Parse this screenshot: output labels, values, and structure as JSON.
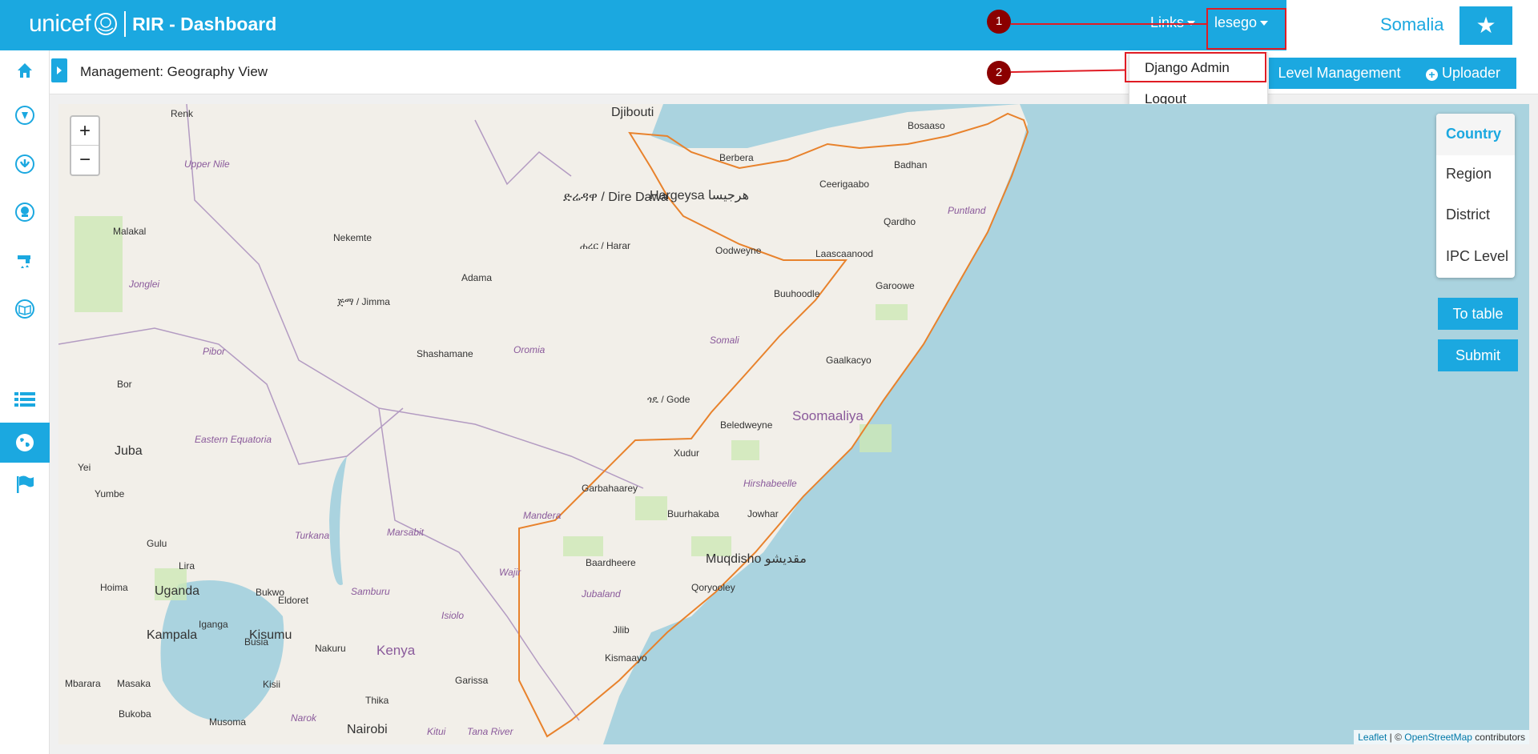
{
  "header": {
    "logo_text": "unicef",
    "app_title": "RIR - Dashboard",
    "links_label": "Links",
    "user_label": "lesego",
    "country": "Somalia"
  },
  "user_menu": {
    "items": [
      "Django Admin",
      "Logout"
    ]
  },
  "annotations": [
    "1",
    "2"
  ],
  "subheader": {
    "title": "Management: Geography View",
    "level_management_label": "Level Management",
    "uploader_label": "Uploader"
  },
  "sidebar": {
    "items": [
      {
        "icon": "home-icon"
      },
      {
        "icon": "nutrition-icon"
      },
      {
        "icon": "protection-icon"
      },
      {
        "icon": "health-icon"
      },
      {
        "icon": "wash-icon"
      },
      {
        "icon": "education-icon"
      },
      {
        "icon": "list-icon"
      },
      {
        "icon": "globe-icon",
        "active": true
      },
      {
        "icon": "flag-icon"
      }
    ]
  },
  "map": {
    "zoom_in": "+",
    "zoom_out": "−",
    "levels": [
      "Country",
      "Region",
      "District",
      "IPC Level"
    ],
    "active_level": "Country",
    "to_table_label": "To table",
    "submit_label": "Submit",
    "attribution": {
      "leaflet": "Leaflet",
      "sep": " | © ",
      "osm": "OpenStreetMap",
      "suffix": " contributors"
    },
    "labels": [
      {
        "text": "Djibouti",
        "cls": "big"
      },
      {
        "text": "Hargeysa هرجيسا",
        "cls": "big"
      },
      {
        "text": "Berbera",
        "cls": ""
      },
      {
        "text": "Bosaaso",
        "cls": ""
      },
      {
        "text": "Ceerigaabo",
        "cls": ""
      },
      {
        "text": "Badhan",
        "cls": ""
      },
      {
        "text": "Qardho",
        "cls": ""
      },
      {
        "text": "Puntland",
        "cls": "region"
      },
      {
        "text": "Oodweyne",
        "cls": ""
      },
      {
        "text": "Laascaanood",
        "cls": ""
      },
      {
        "text": "Garoowe",
        "cls": ""
      },
      {
        "text": "Buuhoodle",
        "cls": ""
      },
      {
        "text": "Gaalkacyo",
        "cls": ""
      },
      {
        "text": "Soomaaliya",
        "cls": "country"
      },
      {
        "text": "Beledweyne",
        "cls": ""
      },
      {
        "text": "Xudur",
        "cls": ""
      },
      {
        "text": "Garbahaarey",
        "cls": ""
      },
      {
        "text": "Buurhakaba",
        "cls": ""
      },
      {
        "text": "Jowhar",
        "cls": ""
      },
      {
        "text": "Hirshabeelle",
        "cls": "region"
      },
      {
        "text": "Muqdisho مقديشو",
        "cls": "big"
      },
      {
        "text": "Baardheere",
        "cls": ""
      },
      {
        "text": "Qoryooley",
        "cls": ""
      },
      {
        "text": "Jubaland",
        "cls": "region"
      },
      {
        "text": "Jilib",
        "cls": ""
      },
      {
        "text": "Kismaayo",
        "cls": ""
      },
      {
        "text": "ጎዴ / Gode",
        "cls": ""
      },
      {
        "text": "Adama",
        "cls": ""
      },
      {
        "text": "ጅማ / Jimma",
        "cls": ""
      },
      {
        "text": "ሐረር / Harar",
        "cls": ""
      },
      {
        "text": "ድሬዳዋ / Dire Dawa",
        "cls": "big"
      },
      {
        "text": "Nekemte",
        "cls": ""
      },
      {
        "text": "Shashamane",
        "cls": ""
      },
      {
        "text": "Malakal",
        "cls": ""
      },
      {
        "text": "Renk",
        "cls": ""
      },
      {
        "text": "Bor",
        "cls": ""
      },
      {
        "text": "Juba",
        "cls": "big"
      },
      {
        "text": "Yei",
        "cls": ""
      },
      {
        "text": "Yumbe",
        "cls": ""
      },
      {
        "text": "Gulu",
        "cls": ""
      },
      {
        "text": "Lira",
        "cls": ""
      },
      {
        "text": "Uganda",
        "cls": "big"
      },
      {
        "text": "Kampala",
        "cls": "big"
      },
      {
        "text": "Hoima",
        "cls": ""
      },
      {
        "text": "Kisumu",
        "cls": "big"
      },
      {
        "text": "Kenya",
        "cls": "country"
      },
      {
        "text": "Nairobi",
        "cls": "big"
      },
      {
        "text": "Eldoret",
        "cls": ""
      },
      {
        "text": "Nakuru",
        "cls": ""
      },
      {
        "text": "Garissa",
        "cls": ""
      },
      {
        "text": "Upper Nile",
        "cls": "region"
      },
      {
        "text": "Jonglei",
        "cls": "region"
      },
      {
        "text": "Pibor",
        "cls": "region"
      },
      {
        "text": "Eastern Equatoria",
        "cls": "region"
      },
      {
        "text": "Turkana",
        "cls": "region"
      },
      {
        "text": "Marsabit",
        "cls": "region"
      },
      {
        "text": "Samburu",
        "cls": "region"
      },
      {
        "text": "Isiolo",
        "cls": "region"
      },
      {
        "text": "Wajir",
        "cls": "region"
      },
      {
        "text": "Mandera",
        "cls": "region"
      },
      {
        "text": "Somali",
        "cls": "region"
      },
      {
        "text": "Oromia",
        "cls": "region"
      },
      {
        "text": "Tana River",
        "cls": "region"
      },
      {
        "text": "Kitui",
        "cls": "region"
      },
      {
        "text": "Narok",
        "cls": "region"
      },
      {
        "text": "Busia",
        "cls": ""
      },
      {
        "text": "Bukwo",
        "cls": ""
      },
      {
        "text": "Iganga",
        "cls": ""
      },
      {
        "text": "Kisii",
        "cls": ""
      },
      {
        "text": "Thika",
        "cls": ""
      },
      {
        "text": "Masaka",
        "cls": ""
      },
      {
        "text": "Mbarara",
        "cls": ""
      },
      {
        "text": "Bukoba",
        "cls": ""
      },
      {
        "text": "Musoma",
        "cls": ""
      }
    ]
  }
}
